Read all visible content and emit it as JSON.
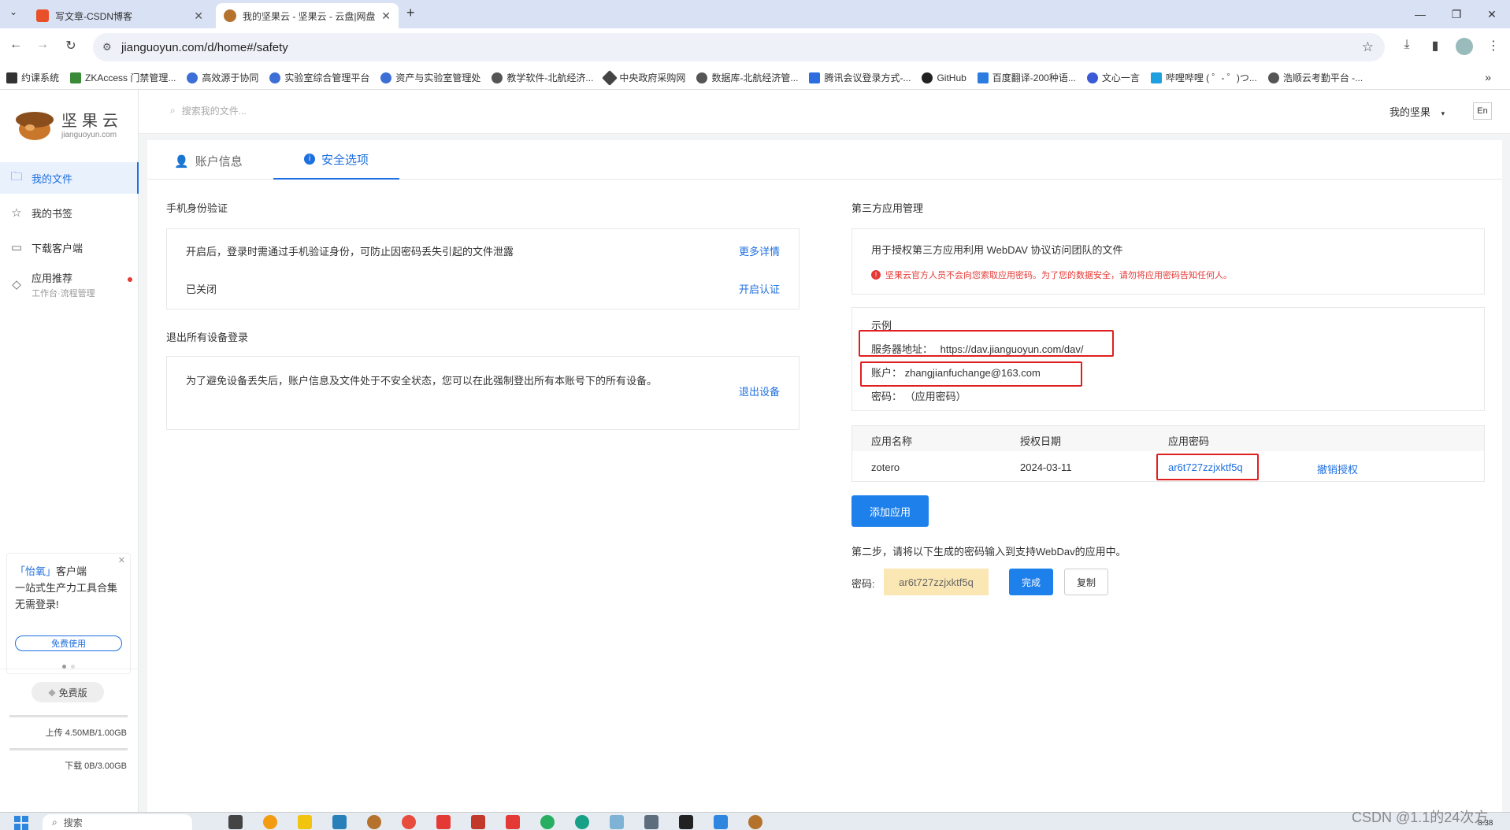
{
  "browser": {
    "tabs": [
      {
        "title": "写文章-CSDN博客"
      },
      {
        "title": "我的坚果云 - 坚果云 - 云盘|网盘"
      }
    ],
    "url": "jianguoyun.com/d/home#/safety",
    "bookmarks": [
      "约课系统",
      "ZKAccess 门禁管理...",
      "高效源于协同",
      "实验室综合管理平台",
      "资产与实验室管理处",
      "教学软件-北航经济...",
      "中央政府采购网",
      "数据库-北航经济管...",
      "腾讯会议登录方式-...",
      "GitHub",
      "百度翻译-200种语...",
      "文心一言",
      "哔哩哔哩 ( ゜- ゜)つ...",
      "浩顺云考勤平台 -..."
    ]
  },
  "brand": {
    "name": "坚果云",
    "domain": "jianguoyun.com"
  },
  "search": {
    "placeholder": "搜索我的文件..."
  },
  "header": {
    "my_nut": "我的坚果",
    "lang": "En"
  },
  "sidebar": {
    "items": [
      {
        "label": "我的文件"
      },
      {
        "label": "我的书签"
      },
      {
        "label": "下载客户端"
      },
      {
        "label": "应用推荐",
        "sub": "工作台·流程管理"
      }
    ],
    "promo": {
      "title_highlight": "「怡氧」",
      "title_rest": "客户端",
      "body": "一站式生产力工具合集 无需登录!",
      "button": "免费使用"
    },
    "plan": "免费版",
    "upload": "上传 4.50MB/1.00GB",
    "download": "下载 0B/3.00GB"
  },
  "tabs": [
    {
      "label": "账户信息"
    },
    {
      "label": "安全选项"
    }
  ],
  "phone_auth": {
    "title": "手机身份验证",
    "desc": "开启后，登录时需通过手机验证身份，可防止因密码丢失引起的文件泄露",
    "more": "更多详情",
    "status": "已关闭",
    "enable": "开启认证"
  },
  "logout_all": {
    "title": "退出所有设备登录",
    "desc": "为了避免设备丢失后，账户信息及文件处于不安全状态，您可以在此强制登出所有本账号下的所有设备。",
    "button": "退出设备"
  },
  "third_party": {
    "title": "第三方应用管理",
    "desc": "用于授权第三方应用利用 WebDAV 协议访问团队的文件",
    "warning": "坚果云官方人员不会向您索取应用密码。为了您的数据安全，请勿将应用密码告知任何人。",
    "example_title": "示例",
    "server_label": "服务器地址：",
    "server_value": "https://dav.jianguoyun.com/dav/",
    "account_label": "账户：",
    "account_value": "zhangjianfuchange@163.com",
    "password_label": "密码：",
    "password_value": "（应用密码）",
    "table": {
      "headers": [
        "应用名称",
        "授权日期",
        "应用密码"
      ],
      "rows": [
        {
          "name": "zotero",
          "date": "2024-03-11",
          "password": "ar6t727zzjxktf5q",
          "action": "撤销授权"
        }
      ]
    },
    "add_button": "添加应用",
    "step2": "第二步，请将以下生成的密码输入到支持WebDav的应用中。",
    "pw_label": "密码:",
    "pw_value": "ar6t727zzjxktf5q",
    "done": "完成",
    "copy": "复制"
  },
  "taskbar": {
    "search": "搜索",
    "time": "8:38"
  },
  "watermark": "CSDN @1.1的24次方"
}
